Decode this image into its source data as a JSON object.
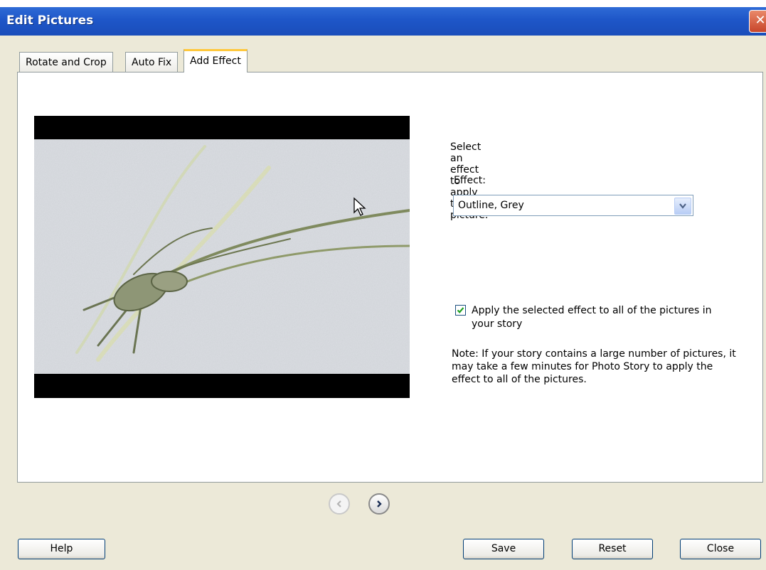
{
  "window": {
    "title": "Edit Pictures",
    "close_glyph": "✕"
  },
  "tabs": [
    {
      "label": "Rotate and Crop",
      "active": false
    },
    {
      "label": "Auto Fix",
      "active": false
    },
    {
      "label": "Add Effect",
      "active": true
    }
  ],
  "effect_panel": {
    "instruction": "Select an effect to apply to this picture.",
    "effect_label": "Effect:",
    "effect_value": "Outline, Grey",
    "apply_all_checked": true,
    "apply_all_label": "Apply the selected effect to all of the pictures in your story",
    "note": "Note: If your story contains a large number of pictures, it may take a few minutes for Photo Story to apply the effect to all of the pictures."
  },
  "icons": {
    "prev": "chevron-left-icon",
    "next": "chevron-right-icon",
    "dropdown": "chevron-down-icon",
    "check": "checkmark-icon"
  },
  "buttons": {
    "help": "Help",
    "save": "Save",
    "reset": "Reset",
    "close": "Close"
  },
  "colors": {
    "titlebar": "#1E56C8",
    "dialog_bg": "#ECE9D8",
    "tab_accent": "#FFC83C"
  }
}
